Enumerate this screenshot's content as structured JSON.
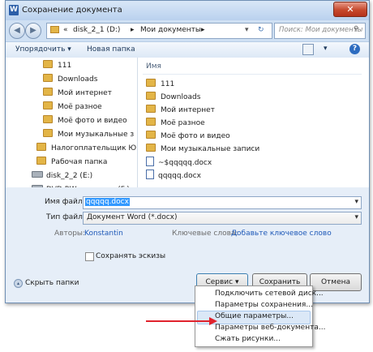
{
  "window": {
    "title": "Сохранение документа",
    "close_glyph": "✕"
  },
  "nav": {
    "back_glyph": "◀",
    "forward_glyph": "▶",
    "address": {
      "prefix": "«",
      "segment1": "disk_2_1 (D:)",
      "segment2": "Мои документы",
      "separator": "▸"
    },
    "search_placeholder": "Поиск: Мои документы"
  },
  "toolbar": {
    "organize": "Упорядочить ▾",
    "new_folder": "Новая папка"
  },
  "tree": {
    "items": [
      {
        "label": "111",
        "kind": "folder"
      },
      {
        "label": "Downloads",
        "kind": "folder"
      },
      {
        "label": "Мой интернет",
        "kind": "folder"
      },
      {
        "label": "Моё разное",
        "kind": "folder"
      },
      {
        "label": "Моё фото и видео",
        "kind": "folder"
      },
      {
        "label": "Мои музыкальные з",
        "kind": "folder"
      },
      {
        "label": "Налогоплательщик Ю",
        "kind": "folder"
      },
      {
        "label": "Рабочая папка",
        "kind": "folder"
      },
      {
        "label": "disk_2_2 (E:)",
        "kind": "drive"
      },
      {
        "label": "DVD RW дисковод (F:)",
        "kind": "drive"
      }
    ]
  },
  "files": {
    "column_name": "Имя",
    "items": [
      {
        "label": "111",
        "kind": "folder"
      },
      {
        "label": "Downloads",
        "kind": "folder"
      },
      {
        "label": "Мой интернет",
        "kind": "folder"
      },
      {
        "label": "Моё разное",
        "kind": "folder"
      },
      {
        "label": "Моё фото и видео",
        "kind": "folder"
      },
      {
        "label": "Мои музыкальные записи",
        "kind": "folder"
      },
      {
        "label": "~$qqqqq.docx",
        "kind": "doc"
      },
      {
        "label": "qqqqq.docx",
        "kind": "doc"
      }
    ]
  },
  "form": {
    "filename_label": "Имя файла:",
    "filename_value": "qqqqq.docx",
    "filetype_label": "Тип файла:",
    "filetype_value": "Документ Word (*.docx)",
    "authors_label": "Авторы:",
    "authors_value": "Konstantin",
    "keywords_label": "Ключевые слова:",
    "keywords_value": "Добавьте ключевое слово",
    "thumbnails_label": "Сохранять эскизы"
  },
  "footer": {
    "hide_folders": "Скрыть папки",
    "service": "Сервис",
    "save": "Сохранить",
    "cancel": "Отмена"
  },
  "service_menu": {
    "items": [
      "Подключить сетевой диск...",
      "Параметры сохранения...",
      "Общие параметры...",
      "Параметры веб-документа...",
      "Сжать рисунки..."
    ],
    "highlighted_index": 2
  },
  "colors": {
    "annotation_arrow": "#e0232d",
    "selection": "#3399ff"
  }
}
